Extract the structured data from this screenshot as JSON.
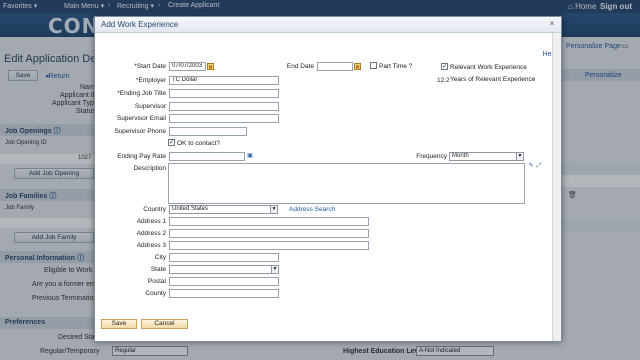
{
  "topbar": {
    "favorites": "Favorites",
    "main_menu": "Main Menu",
    "recruiting": "Recruiting",
    "create_applicant": "Create Applicant",
    "home": "Home",
    "sign_out": "Sign out",
    "sep": "›"
  },
  "brand": {
    "logo_text": "CONN"
  },
  "background": {
    "page_title": "Edit Application Detail",
    "save_button": "Save",
    "return_link": "Return",
    "personalize_page": "Personalize Page",
    "personalize": "Personalize",
    "name_label": "Name",
    "applicant_id_label": "Applicant ID",
    "applicant_type_label": "Applicant Type",
    "status_label": "Status",
    "job_openings_section": "Job Openings",
    "job_opening_id_label": "Job Opening ID",
    "job_opening_id_value": "1027",
    "add_job_opening_button": "Add Job Opening",
    "job_families_section": "Job Families",
    "job_family_label": "Job Family",
    "add_job_family_button": "Add Job Family",
    "personal_info_section": "Personal Information",
    "eligible_label": "Eligible to Work in",
    "former_emp_label": "Are you a former emp",
    "previous_termination_label": "Previous Termination",
    "preferences_section": "Preferences",
    "desired_start_label": "Desired Star",
    "regular_temporary_label": "Regular/Temporary",
    "regular_temporary_value": "Regular",
    "highest_education_label": "Highest Education Level",
    "highest_education_value": "A-Not Indicated"
  },
  "modal": {
    "title": "Add Work Experience",
    "help": "Help",
    "close": "×",
    "start_date_label": "Start Date",
    "start_date_value": "07/07/2003",
    "end_date_label": "End Date",
    "end_date_value": "",
    "part_time_label": "Part Time ?",
    "relevant_work_label": "Relevant Work Experience",
    "years_relevant_value": "12.2",
    "years_relevant_label": "Years of Relevant Experience",
    "employer_label": "Employer",
    "employer_value": "TC Dollar",
    "ending_job_title_label": "Ending Job Title",
    "supervisor_label": "Supervisor",
    "supervisor_email_label": "Supervisor Email",
    "supervisor_phone_label": "Supervisor Phone",
    "ok_to_contact_label": "OK to contact?",
    "ending_pay_rate_label": "Ending Pay Rate",
    "frequency_label": "Frequency",
    "frequency_value": "Month",
    "description_label": "Description",
    "country_label": "Country",
    "country_value": "United States",
    "address_search_link": "Address Search",
    "address1_label": "Address 1",
    "address2_label": "Address 2",
    "address3_label": "Address 3",
    "city_label": "City",
    "state_label": "State",
    "postal_label": "Postal",
    "county_label": "County",
    "save_button": "Save",
    "cancel_button": "Cancel"
  },
  "colors": {
    "topbar": "#2b4b73",
    "link": "#1f5aa6",
    "button_fill": "#f3d9a8"
  },
  "icons": {
    "calendar": "calendar-icon",
    "close": "close-icon",
    "dropdown": "chevron-down-icon",
    "spellcheck": "spellcheck-icon",
    "delete": "trash-icon"
  }
}
